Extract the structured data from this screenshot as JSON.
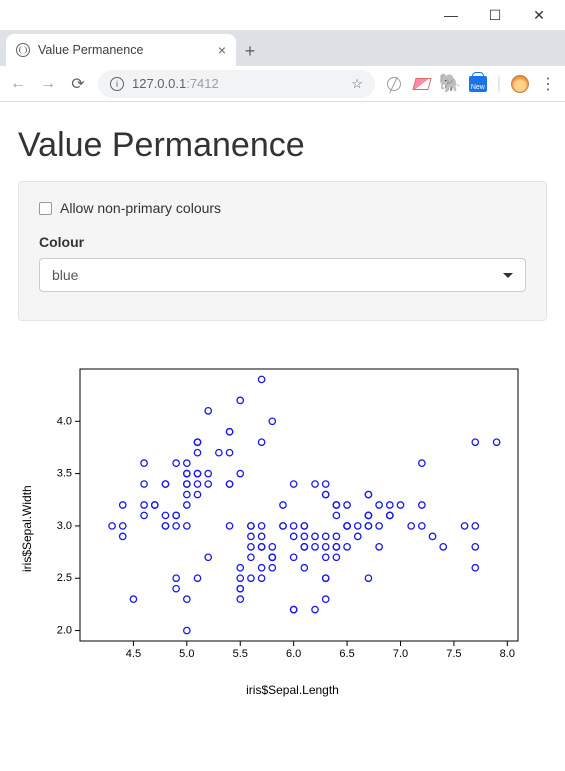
{
  "browser": {
    "tab_title": "Value Permanence",
    "url_host": "127.0.0.1",
    "url_port": ":7412"
  },
  "page": {
    "heading": "Value Permanence",
    "checkbox_label": "Allow non-primary colours",
    "select_label": "Colour",
    "select_value": "blue"
  },
  "chart_data": {
    "type": "scatter",
    "xlabel": "iris$Sepal.Length",
    "ylabel": "iris$Sepal.Width",
    "xlim": [
      4.0,
      8.1
    ],
    "ylim": [
      1.9,
      4.5
    ],
    "xticks": [
      4.5,
      5.0,
      5.5,
      6.0,
      6.5,
      7.0,
      7.5,
      8.0
    ],
    "yticks": [
      2.0,
      2.5,
      3.0,
      3.5,
      4.0
    ],
    "point_color": "#1a1ae6",
    "x": [
      5.1,
      4.9,
      4.7,
      4.6,
      5.0,
      5.4,
      4.6,
      5.0,
      4.4,
      4.9,
      5.4,
      4.8,
      4.8,
      4.3,
      5.8,
      5.7,
      5.4,
      5.1,
      5.7,
      5.1,
      5.4,
      5.1,
      4.6,
      5.1,
      4.8,
      5.0,
      5.0,
      5.2,
      5.2,
      4.7,
      4.8,
      5.4,
      5.2,
      5.5,
      4.9,
      5.0,
      5.5,
      4.9,
      4.4,
      5.1,
      5.0,
      4.5,
      4.4,
      5.0,
      5.1,
      4.8,
      5.1,
      4.6,
      5.3,
      5.0,
      7.0,
      6.4,
      6.9,
      5.5,
      6.5,
      5.7,
      6.3,
      4.9,
      6.6,
      5.2,
      5.0,
      5.9,
      6.0,
      6.1,
      5.6,
      6.7,
      5.6,
      5.8,
      6.2,
      5.6,
      5.9,
      6.1,
      6.3,
      6.1,
      6.4,
      6.6,
      6.8,
      6.7,
      6.0,
      5.7,
      5.5,
      5.5,
      5.8,
      6.0,
      5.4,
      6.0,
      6.7,
      6.3,
      5.6,
      5.5,
      5.5,
      6.1,
      5.8,
      5.0,
      5.6,
      5.7,
      5.7,
      6.2,
      5.1,
      5.7,
      6.3,
      5.8,
      7.1,
      6.3,
      6.5,
      7.6,
      4.9,
      7.3,
      6.7,
      7.2,
      6.5,
      6.4,
      6.8,
      5.7,
      5.8,
      6.4,
      6.5,
      7.7,
      7.7,
      6.0,
      6.9,
      5.6,
      7.7,
      6.3,
      6.7,
      7.2,
      6.2,
      6.1,
      6.4,
      7.2,
      7.4,
      7.9,
      6.4,
      6.3,
      6.1,
      7.7,
      6.3,
      6.4,
      6.0,
      6.9,
      6.7,
      6.9,
      5.8,
      6.8,
      6.7,
      6.7,
      6.3,
      6.5,
      6.2,
      5.9
    ],
    "y": [
      3.5,
      3.0,
      3.2,
      3.1,
      3.6,
      3.9,
      3.4,
      3.4,
      2.9,
      3.1,
      3.7,
      3.4,
      3.0,
      3.0,
      4.0,
      4.4,
      3.9,
      3.5,
      3.8,
      3.8,
      3.4,
      3.7,
      3.6,
      3.3,
      3.4,
      3.0,
      3.4,
      3.5,
      3.4,
      3.2,
      3.1,
      3.4,
      4.1,
      4.2,
      3.1,
      3.2,
      3.5,
      3.6,
      3.0,
      3.4,
      3.5,
      2.3,
      3.2,
      3.5,
      3.8,
      3.0,
      3.8,
      3.2,
      3.7,
      3.3,
      3.2,
      3.2,
      3.1,
      2.3,
      2.8,
      2.8,
      3.3,
      2.4,
      2.9,
      2.7,
      2.0,
      3.0,
      2.2,
      2.9,
      2.9,
      3.1,
      3.0,
      2.7,
      2.2,
      2.5,
      3.2,
      2.8,
      2.5,
      2.8,
      2.9,
      3.0,
      2.8,
      3.0,
      2.9,
      2.6,
      2.4,
      2.4,
      2.7,
      2.7,
      3.0,
      3.4,
      3.1,
      2.3,
      3.0,
      2.5,
      2.6,
      3.0,
      2.6,
      2.3,
      2.7,
      3.0,
      2.9,
      2.9,
      2.5,
      2.8,
      3.3,
      2.7,
      3.0,
      2.9,
      3.0,
      3.0,
      2.5,
      2.9,
      2.5,
      3.6,
      3.2,
      2.7,
      3.0,
      2.5,
      2.8,
      3.2,
      3.0,
      3.8,
      2.6,
      2.2,
      3.2,
      2.8,
      2.8,
      2.7,
      3.3,
      3.2,
      2.8,
      3.0,
      2.8,
      3.0,
      2.8,
      3.8,
      2.8,
      2.8,
      2.6,
      3.0,
      3.4,
      3.1,
      3.0,
      3.1,
      3.1,
      3.1,
      2.7,
      3.2,
      3.3,
      3.0,
      2.5,
      3.0,
      3.4,
      3.0
    ]
  }
}
